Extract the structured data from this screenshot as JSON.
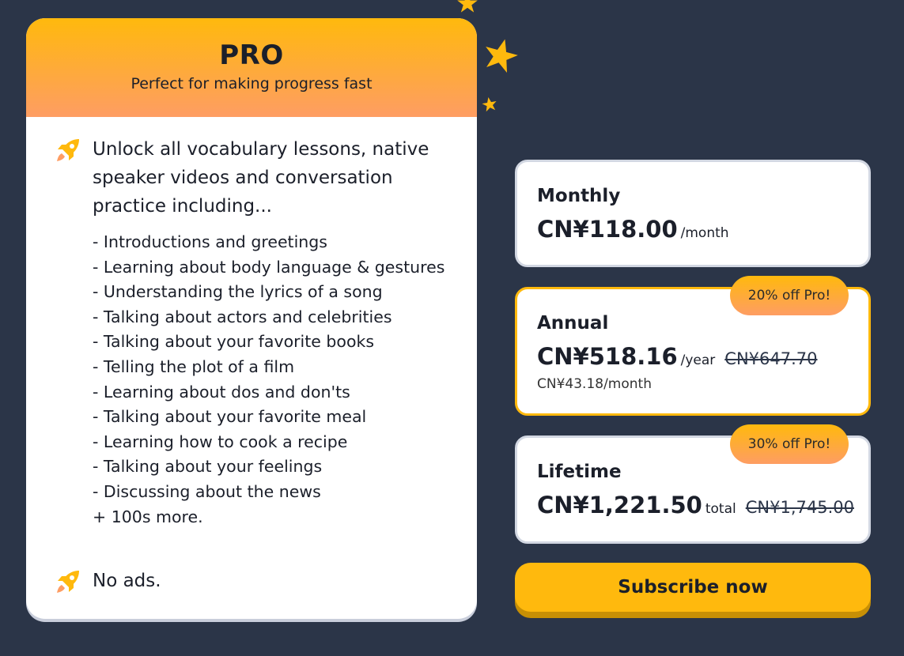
{
  "pro": {
    "title": "PRO",
    "subtitle": "Perfect for making progress fast",
    "feature_main": "Unlock all vocabulary lessons, native speaker videos and conversation practice including...",
    "topics": [
      "- Introductions and greetings",
      "- Learning about body language & gestures",
      "- Understanding the lyrics of a song",
      "- Talking about actors and celebrities",
      "- Talking about your favorite books",
      "- Telling the plot of a film",
      "- Learning about dos and don'ts",
      "- Talking about your favorite meal",
      "- Learning how to cook a recipe",
      "- Talking about your feelings",
      "- Discussing about the news",
      "+ 100s more."
    ],
    "feature_no_ads": "No ads."
  },
  "plans": {
    "monthly": {
      "name": "Monthly",
      "price": "CN¥118.00",
      "period": "/month"
    },
    "annual": {
      "name": "Annual",
      "price": "CN¥518.16",
      "period": "/year",
      "old_price": "CN¥647.70",
      "per_month": "CN¥43.18/month",
      "badge": "20% off Pro!"
    },
    "lifetime": {
      "name": "Lifetime",
      "price": "CN¥1,221.50",
      "period": "total",
      "old_price": "CN¥1,745.00",
      "badge": "30% off Pro!"
    }
  },
  "subscribe_label": "Subscribe now",
  "colors": {
    "background": "#2b3548",
    "accent": "#ffb90d",
    "accent_gradient_end": "#fe9d63",
    "card_border": "#d2d7e2"
  },
  "icons": {
    "feature": "rocket-icon",
    "decor": "star-icon"
  }
}
